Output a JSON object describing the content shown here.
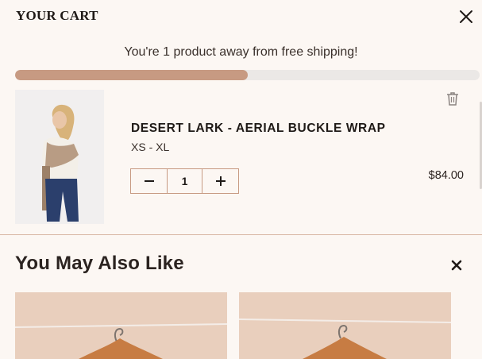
{
  "cart": {
    "title": "YOUR CART",
    "shipping_message": "You're 1 product away from free shipping!",
    "shipping_progress": 0.5
  },
  "item": {
    "name": "DESERT LARK - AERIAL BUCKLE WRAP",
    "variant": "XS - XL",
    "quantity": "1",
    "price": "$84.00",
    "image": "model-wearing-buckle-wrap"
  },
  "recommendations": {
    "title": "You May Also Like",
    "cards": [
      "hanger-product-1",
      "hanger-product-2"
    ]
  },
  "icons": {
    "close": "close-icon",
    "trash": "trash-icon",
    "minus": "minus-icon",
    "plus": "plus-icon",
    "dismiss": "dismiss-icon"
  },
  "colors": {
    "background": "#fcf7f3",
    "accent": "#c79a82",
    "track": "#ebe8e6",
    "card": "#e9cfbd"
  }
}
